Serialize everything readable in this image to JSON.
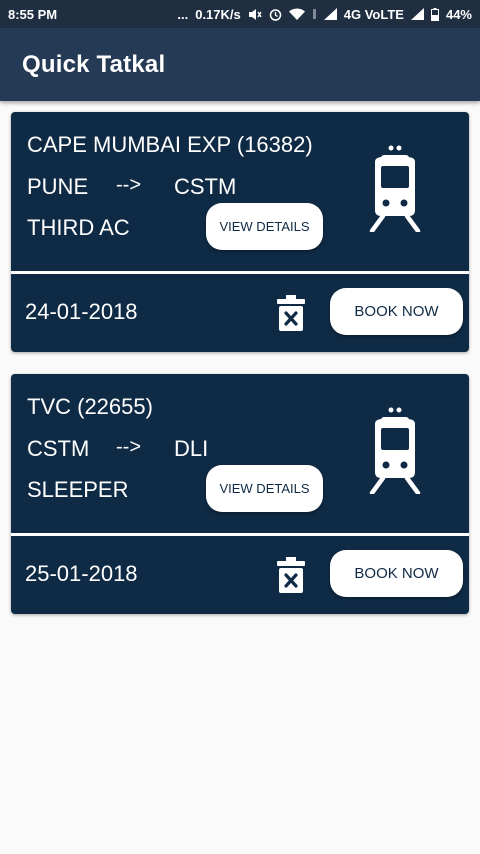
{
  "status_bar": {
    "time": "8:55 PM",
    "dots": "...",
    "speed": "0.17K/s",
    "network": "4G VoLTE",
    "battery": "44%"
  },
  "app_bar": {
    "title": "Quick Tatkal"
  },
  "bookings": [
    {
      "train": "CAPE MUMBAI EXP (16382)",
      "from": "PUNE",
      "arrow": "-->",
      "to": "CSTM",
      "class": "THIRD AC",
      "view_label": "VIEW DETAILS",
      "date": "24-01-2018",
      "book_label": "BOOK NOW"
    },
    {
      "train": "TVC (22655)",
      "from": "CSTM",
      "arrow": "-->",
      "to": "DLI",
      "class": "SLEEPER",
      "view_label": "VIEW DETAILS",
      "date": "25-01-2018",
      "book_label": "BOOK NOW"
    }
  ],
  "colors": {
    "status_bar": "#1f2f41",
    "app_bar": "#253a55",
    "card": "#0f2a45",
    "background": "#fafafa"
  }
}
